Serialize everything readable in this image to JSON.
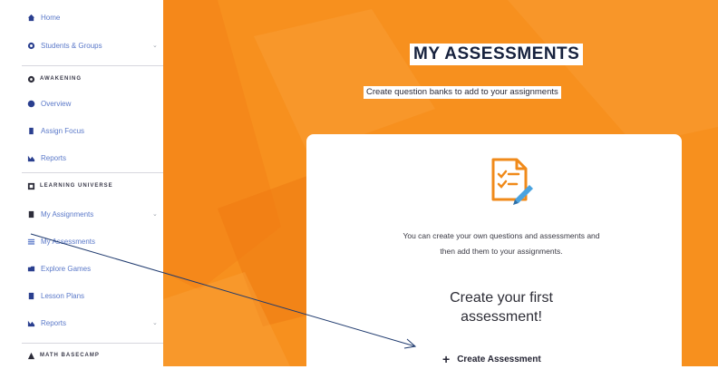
{
  "sidebar": {
    "items": [
      {
        "label": "Home",
        "icon": "home-icon"
      },
      {
        "label": "Students & Groups",
        "icon": "students-icon",
        "expandable": true
      },
      {
        "label": "Overview",
        "icon": "overview-icon"
      },
      {
        "label": "Assign Focus",
        "icon": "assign-icon"
      },
      {
        "label": "Reports",
        "icon": "reports-icon"
      },
      {
        "label": "My Assignments",
        "icon": "assignments-icon",
        "expandable": true
      },
      {
        "label": "My Assessments",
        "icon": "assessments-icon"
      },
      {
        "label": "Explore Games",
        "icon": "games-icon"
      },
      {
        "label": "Lesson Plans",
        "icon": "lesson-icon"
      },
      {
        "label": "Reports",
        "icon": "reports-icon",
        "expandable": true
      }
    ],
    "sections": [
      "AWAKENING",
      "LEARNING UNIVERSE",
      "MATH BASECAMP"
    ],
    "chevron": "⌄"
  },
  "main": {
    "title": "MY ASSESSMENTS",
    "subtitle": "Create question banks to add to your assignments",
    "card": {
      "description_line1": "You can create your own questions and assessments and",
      "description_line2": "then add them to your assignments.",
      "heading_line1": "Create your first",
      "heading_line2": "assessment!",
      "button_plus": "+",
      "button_label": "Create Assessment"
    }
  },
  "colors": {
    "accent": "#f7901e",
    "accent_dark": "#ef7d10",
    "sidebar_text": "#5b79c9",
    "title_text": "#16213d"
  }
}
